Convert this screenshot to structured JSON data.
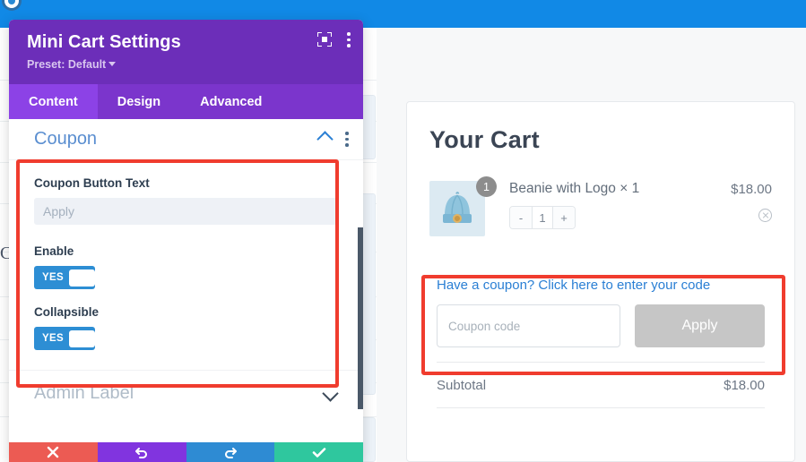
{
  "topbar": {
    "icon": "wp-logo-dot"
  },
  "modal": {
    "title": "Mini Cart Settings",
    "preset_label": "Preset: Default",
    "icons": {
      "focus": "focus-mode-icon",
      "menu": "kebab-menu-icon"
    },
    "tabs": [
      {
        "label": "Content",
        "active": true
      },
      {
        "label": "Design",
        "active": false
      },
      {
        "label": "Advanced",
        "active": false
      }
    ],
    "sections": [
      {
        "title": "Coupon",
        "expanded": true,
        "fields": [
          {
            "type": "text",
            "label": "Coupon Button Text",
            "value": "",
            "placeholder": "Apply"
          },
          {
            "type": "toggle",
            "label": "Enable",
            "state": "YES"
          },
          {
            "type": "toggle",
            "label": "Collapsible",
            "state": "YES"
          }
        ]
      },
      {
        "title": "Admin Label",
        "expanded": false
      }
    ],
    "actions": [
      {
        "name": "cancel",
        "icon": "close-x-icon",
        "color": "#ec5b53"
      },
      {
        "name": "undo",
        "icon": "undo-arrow-icon",
        "color": "#8134df"
      },
      {
        "name": "redo",
        "icon": "redo-arrow-icon",
        "color": "#2e8bd3"
      },
      {
        "name": "save",
        "icon": "check-icon",
        "color": "#2fc79e"
      }
    ]
  },
  "cart": {
    "title": "Your Cart",
    "item": {
      "name": "Beanie with Logo × 1",
      "badge": "1",
      "qty_minus": "-",
      "qty_value": "1",
      "qty_plus": "+",
      "price": "$18.00",
      "remove_icon": "remove-circle-x-icon",
      "thumb": "beanie-product-image"
    },
    "coupon": {
      "link": "Have a coupon? Click here to enter your code",
      "input_value": "",
      "input_placeholder": "Coupon code",
      "apply_label": "Apply"
    },
    "subtotal_label": "Subtotal",
    "subtotal_value": "$18.00"
  },
  "highlights": {
    "settings_box_color": "#f03c2e",
    "cart_box_color": "#f03c2e"
  }
}
